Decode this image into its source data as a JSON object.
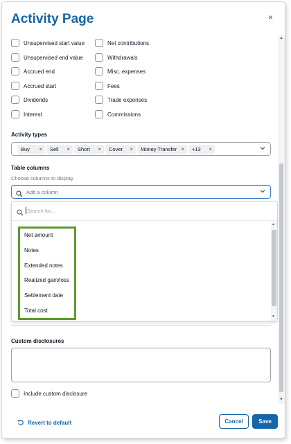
{
  "dialog": {
    "title": "Activity Page",
    "close_glyph": "×"
  },
  "checkboxes_left": [
    {
      "label": "Unsupervised start value",
      "checked": false
    },
    {
      "label": "Unsupervised end value",
      "checked": false
    },
    {
      "label": "Accrued end",
      "checked": false
    },
    {
      "label": "Accrued start",
      "checked": false
    },
    {
      "label": "Dividends",
      "checked": false
    },
    {
      "label": "Interest",
      "checked": false
    }
  ],
  "checkboxes_right": [
    {
      "label": "Net contributions",
      "checked": false
    },
    {
      "label": "Withdrawals",
      "checked": false
    },
    {
      "label": "Misc. expenses",
      "checked": false
    },
    {
      "label": "Fees",
      "checked": false
    },
    {
      "label": "Trade expenses",
      "checked": false
    },
    {
      "label": "Commissions",
      "checked": false
    }
  ],
  "activity_types": {
    "label": "Activity types",
    "chips": [
      "Buy",
      "Sell",
      "Short",
      "Cover",
      "Money Transfer",
      "+13"
    ],
    "remove_glyph": "×",
    "chevron_glyph": "⌄"
  },
  "table_columns": {
    "label": "Table columns",
    "hint": "Choose columns to display.",
    "placeholder": "Add a column",
    "chevron_glyph": "⌄",
    "dropdown": {
      "search_placeholder": "Search for...",
      "options": [
        "Net amount",
        "Notes",
        "Extended notes",
        "Realized gain/loss",
        "Settlement date",
        "Total cost"
      ]
    }
  },
  "custom_disclosures": {
    "label": "Custom disclosures",
    "textarea_value": "",
    "include_label": "Include custom disclosure",
    "include_checked": false,
    "resize_glyph": "⋰"
  },
  "footer": {
    "revert_label": "Revert to default",
    "cancel_label": "Cancel",
    "save_label": "Save"
  },
  "scroll_glyphs": {
    "up": "▲",
    "down": "▼"
  },
  "colors": {
    "accent": "#1565a8",
    "highlight_border": "#5b9a2e"
  },
  "icons": [
    "close-icon",
    "search-icon",
    "chevron-down-icon",
    "revert-icon",
    "resize-grip-icon"
  ]
}
